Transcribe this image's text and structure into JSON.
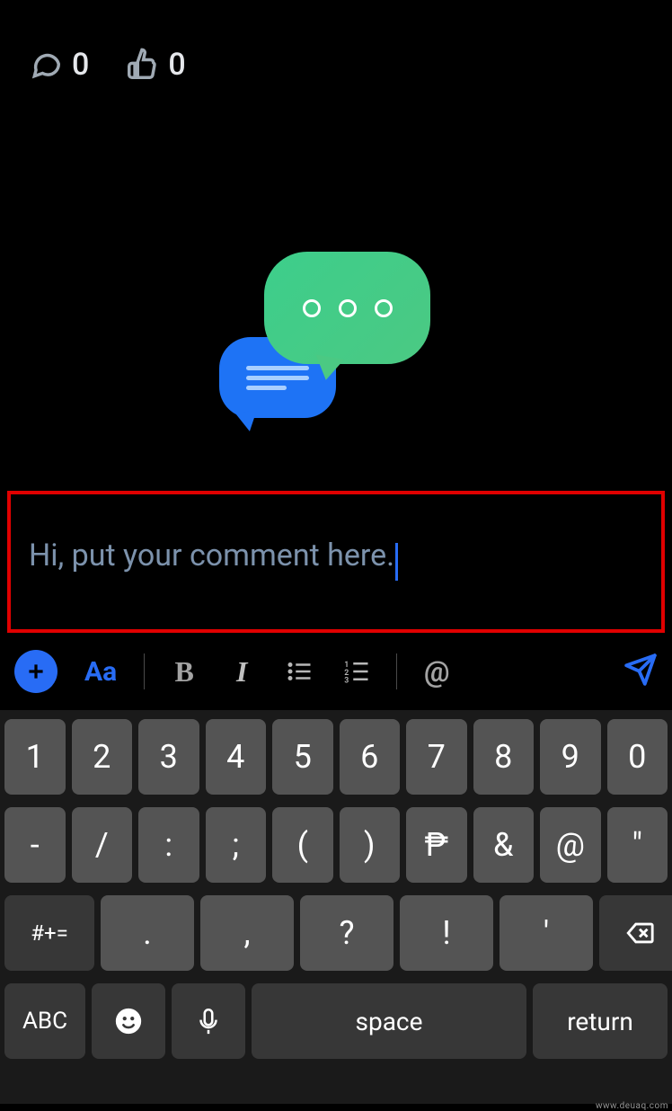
{
  "stats": {
    "comments_count": "0",
    "likes_count": "0"
  },
  "comment_input": {
    "text": "Hi, put your comment here."
  },
  "toolbar": {
    "text_format_label": "Aa",
    "bold_glyph": "B",
    "italic_glyph": "I",
    "mention_glyph": "@"
  },
  "keyboard": {
    "row1": [
      "1",
      "2",
      "3",
      "4",
      "5",
      "6",
      "7",
      "8",
      "9",
      "0"
    ],
    "row2": [
      "-",
      "/",
      ":",
      ";",
      "(",
      ")",
      "₱",
      "&",
      "@",
      "\""
    ],
    "row3_switch": "#+=",
    "row3": [
      ".",
      ",",
      "?",
      "!",
      "'"
    ],
    "row4_abc": "ABC",
    "row4_space": "space",
    "row4_return": "return"
  },
  "watermark": "www.deuaq.com"
}
